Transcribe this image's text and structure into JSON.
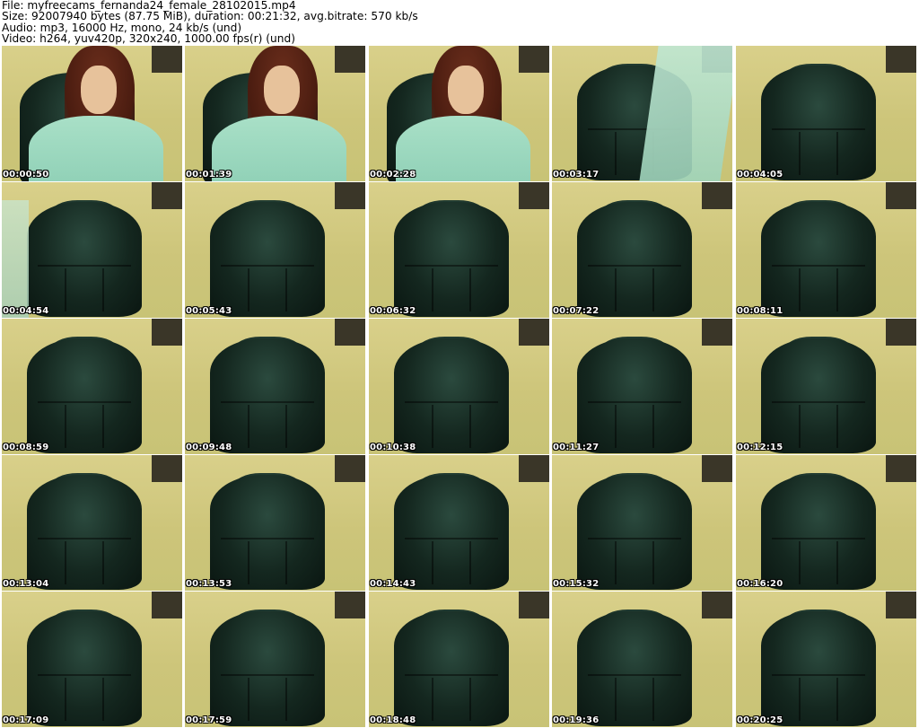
{
  "header": {
    "file_line": "File: myfreecams_fernanda24_female_28102015.mp4",
    "size_line": "Size: 92007940 bytes (87.75 MiB), duration: 00:21:32, avg.bitrate: 570 kb/s",
    "audio_line": "Audio: mp3, 16000 Hz, mono, 24 kb/s (und)",
    "video_line": "Video: h264, yuv420p, 320x240, 1000.00 fps(r) (und)"
  },
  "thumbnails": [
    {
      "time": "00:00:50",
      "scene": "person"
    },
    {
      "time": "00:01:39",
      "scene": "person"
    },
    {
      "time": "00:02:28",
      "scene": "person"
    },
    {
      "time": "00:03:17",
      "scene": "chair-arm"
    },
    {
      "time": "00:04:05",
      "scene": "chair"
    },
    {
      "time": "00:04:54",
      "scene": "chair-side"
    },
    {
      "time": "00:05:43",
      "scene": "chair"
    },
    {
      "time": "00:06:32",
      "scene": "chair"
    },
    {
      "time": "00:07:22",
      "scene": "chair"
    },
    {
      "time": "00:08:11",
      "scene": "chair"
    },
    {
      "time": "00:08:59",
      "scene": "chair"
    },
    {
      "time": "00:09:48",
      "scene": "chair"
    },
    {
      "time": "00:10:38",
      "scene": "chair"
    },
    {
      "time": "00:11:27",
      "scene": "chair"
    },
    {
      "time": "00:12:15",
      "scene": "chair"
    },
    {
      "time": "00:13:04",
      "scene": "chair"
    },
    {
      "time": "00:13:53",
      "scene": "chair"
    },
    {
      "time": "00:14:43",
      "scene": "chair"
    },
    {
      "time": "00:15:32",
      "scene": "chair"
    },
    {
      "time": "00:16:20",
      "scene": "chair"
    },
    {
      "time": "00:17:09",
      "scene": "chair"
    },
    {
      "time": "00:17:59",
      "scene": "chair"
    },
    {
      "time": "00:18:48",
      "scene": "chair"
    },
    {
      "time": "00:19:36",
      "scene": "chair"
    },
    {
      "time": "00:20:25",
      "scene": "chair"
    }
  ]
}
